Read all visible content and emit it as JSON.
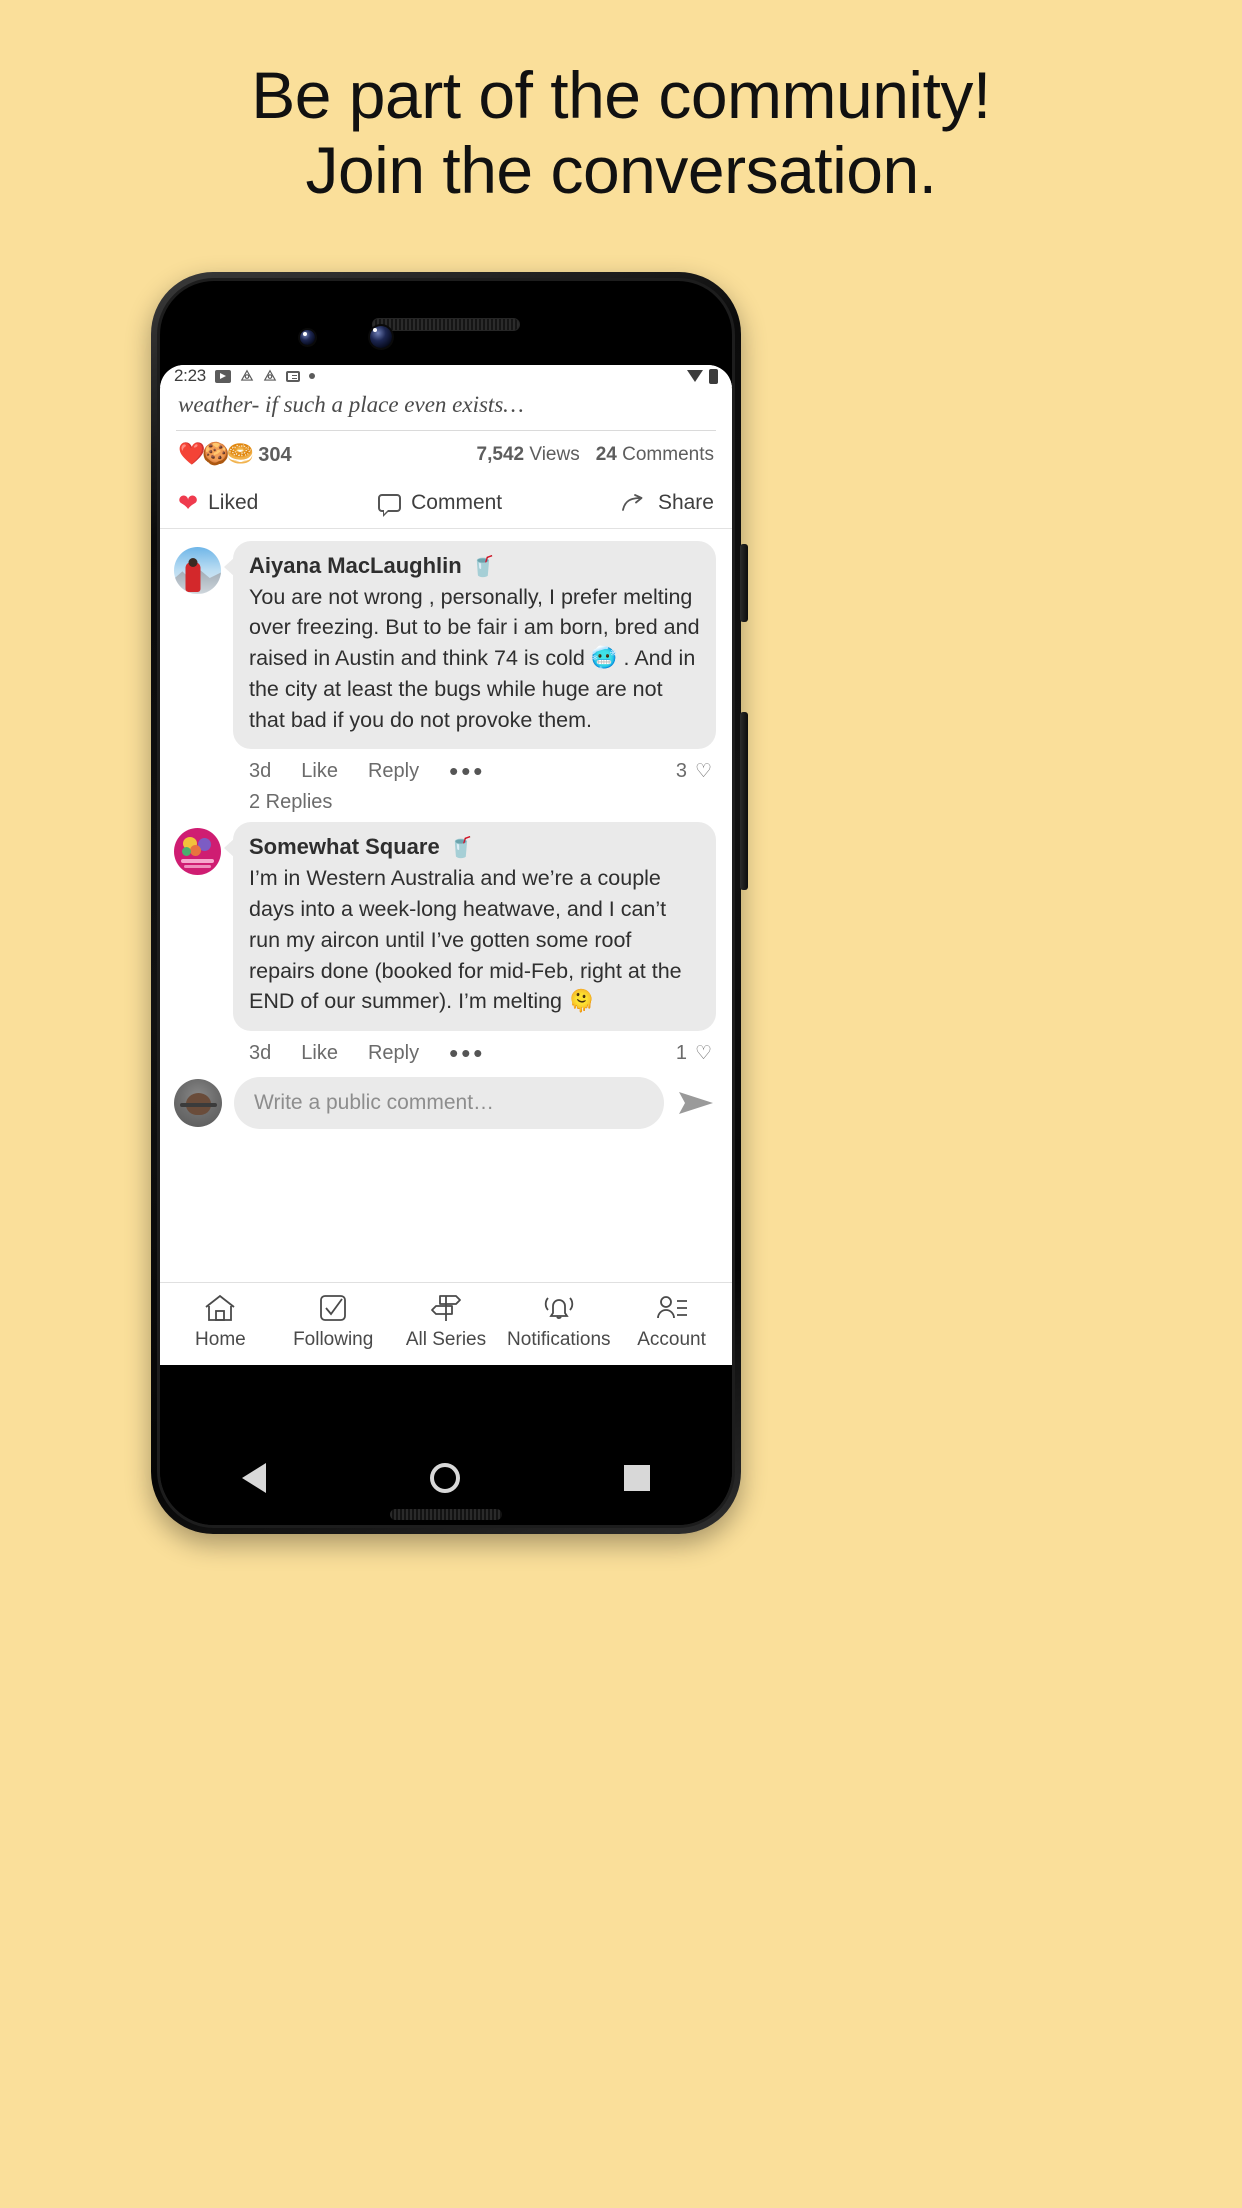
{
  "promo": {
    "line1": "Be part of the community!",
    "line2": "Join the conversation.",
    "background_color": "#fadf9a"
  },
  "status_bar": {
    "time": "2:23",
    "icons": [
      "play-store-icon",
      "drop-alert-icon",
      "drop-alert-icon",
      "news-icon",
      "dot-icon"
    ],
    "right_icons": [
      "wifi-icon",
      "battery-icon"
    ]
  },
  "post": {
    "excerpt": "weather- if such a place even exists…",
    "reactions": {
      "emojis": [
        "❤️",
        "🍪",
        "🥯"
      ],
      "count": "304"
    },
    "views": {
      "count": "7,542",
      "label": "Views"
    },
    "comments": {
      "count": "24",
      "label": "Comments"
    },
    "actions": {
      "like": {
        "label": "Liked",
        "icon": "heart-icon",
        "color": "#ef3b4e"
      },
      "comment": {
        "label": "Comment",
        "icon": "speech-bubble-icon"
      },
      "share": {
        "label": "Share",
        "icon": "share-arrow-icon"
      }
    }
  },
  "comments": [
    {
      "author": "Aiyana MacLaughlin",
      "badge": "🥤",
      "text": "You are not wrong , personally, I prefer melting over freezing. But to be fair i am born, bred and raised in Austin and think 74 is cold 🥶 . And in the city at least the bugs while huge are not that bad if you do not provoke them.",
      "time": "3d",
      "like_label": "Like",
      "reply_label": "Reply",
      "more_label": "•••",
      "like_count": "3",
      "replies_label": "2 Replies"
    },
    {
      "author": "Somewhat Square",
      "badge": "🥤",
      "text": "I’m in Western Australia and we’re a couple days into a week-long heatwave, and I can’t run my aircon until I’ve gotten some roof repairs done (booked for mid-Feb, right at the END of our summer). I’m melting 🫠",
      "time": "3d",
      "like_label": "Like",
      "reply_label": "Reply",
      "more_label": "•••",
      "like_count": "1",
      "replies_label": ""
    }
  ],
  "composer": {
    "placeholder": "Write a public comment…",
    "send_icon": "send-arrow-icon",
    "avatar": "user-avatar"
  },
  "tabbar": {
    "items": [
      {
        "label": "Home",
        "icon": "home-icon"
      },
      {
        "label": "Following",
        "icon": "checkbox-icon"
      },
      {
        "label": "All Series",
        "icon": "signpost-icon"
      },
      {
        "label": "Notifications",
        "icon": "bell-icon"
      },
      {
        "label": "Account",
        "icon": "account-icon"
      }
    ]
  },
  "android_nav": {
    "back": "back-triangle-icon",
    "home": "home-circle-icon",
    "recents": "recents-square-icon"
  }
}
